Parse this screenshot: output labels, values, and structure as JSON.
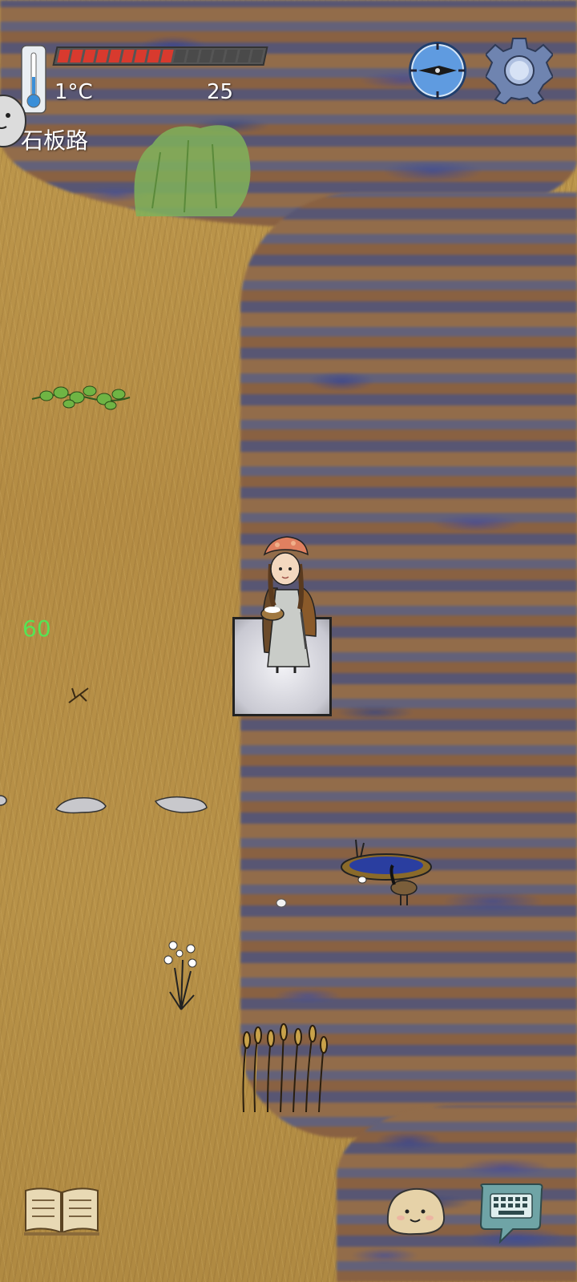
{
  "hud": {
    "temperature": "1°C",
    "food_count": "25",
    "location": "石板路",
    "food_pips_total": 16,
    "food_pips_filled": 9,
    "fps": "60"
  },
  "colors": {
    "food_pip": "#d83a2e",
    "food_pip_empty": "#4a4a4a",
    "fps_text": "#55e455"
  },
  "icons": {
    "thermometer": "thermometer-icon",
    "compass": "compass-icon",
    "settings": "gear-icon",
    "tech_book": "open-book-icon",
    "emote": "smiley-face-icon",
    "chat": "keyboard-speech-bubble-icon"
  }
}
